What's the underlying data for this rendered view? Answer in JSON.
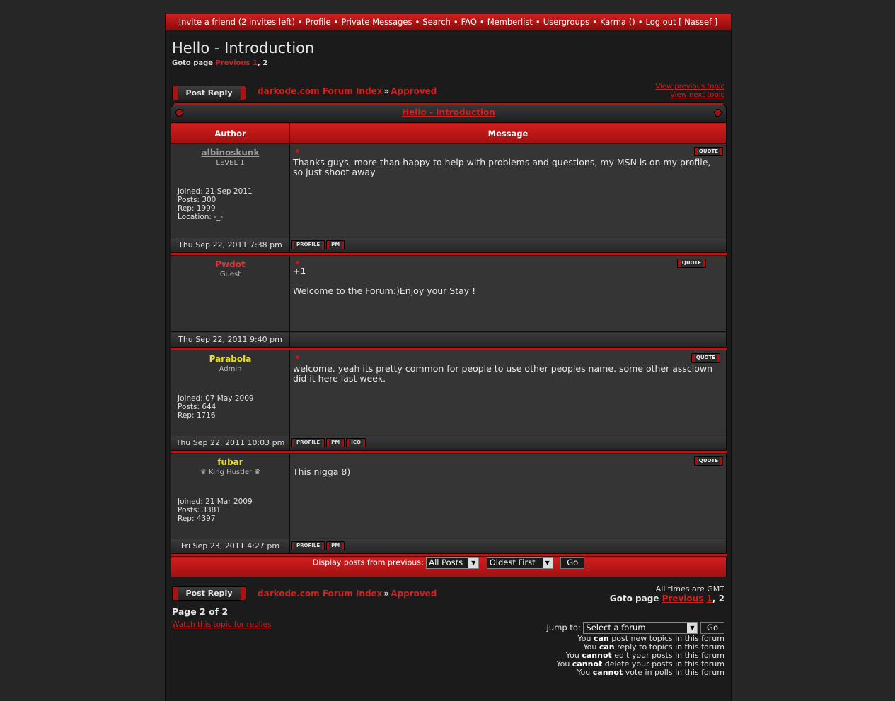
{
  "nav": {
    "items": [
      "Invite a friend (2 invites left)",
      "Profile",
      "Private Messages",
      "Search",
      "FAQ",
      "Memberlist",
      "Usergroups",
      "Karma ()",
      "Log out [ Nassef ]"
    ]
  },
  "topic": {
    "title": "Hello - Introduction",
    "goto_label": "Goto page",
    "goto_prev": "Previous",
    "page1": "1",
    "page2": "2"
  },
  "buttons": {
    "post_reply": "Post Reply",
    "go": "Go",
    "quote": "QUOTE",
    "profile": "PROFILE",
    "pm": "PM",
    "icq": "ICQ"
  },
  "breadcrumb": {
    "index": "darkode.com Forum Index",
    "sep": "»",
    "forum": "Approved"
  },
  "topiclinks": {
    "prev": "View previous topic",
    "next": "View next topic"
  },
  "table": {
    "author_header": "Author",
    "message_header": "Message"
  },
  "posts": [
    {
      "name": "albinoskunk",
      "rank": "LEVEL 1",
      "joined": "Joined: 21 Sep 2011",
      "posts": "Posts: 300",
      "rep": "Rep: 1999",
      "location": "Location: -_-'",
      "body": "Thanks guys, more than happy to help with problems and questions, my MSN is on my profile, so just shoot away",
      "date": "Thu Sep 22, 2011 7:38 pm"
    },
    {
      "name": "Pwdot",
      "rank": "Guest",
      "body1": "+1",
      "body2": "Welcome to the Forum:)Enjoy your Stay !",
      "date": "Thu Sep 22, 2011 9:40 pm"
    },
    {
      "name": "Parabola",
      "rank": "Admin",
      "joined": "Joined: 07 May 2009",
      "posts": "Posts: 644",
      "rep": "Rep: 1716",
      "body": "welcome. yeah its pretty common for people to use other peoples name. some other assclown did it here last week.",
      "date": "Thu Sep 22, 2011 10:03 pm"
    },
    {
      "name": "fubar",
      "rank": "♛ King Hustler ♛",
      "joined": "Joined: 21 Mar 2009",
      "posts": "Posts: 3381",
      "rep": "Rep: 4397",
      "body": "This nigga 8)",
      "date": "Fri Sep 23, 2011 4:27 pm"
    }
  ],
  "display": {
    "label": "Display posts from previous:",
    "range": "All Posts",
    "order": "Oldest First"
  },
  "footer": {
    "timezone": "All times are GMT",
    "page_of": "Page 2 of 2",
    "watch": "Watch this topic for replies",
    "jump_label": "Jump to:",
    "jump_value": "Select a forum"
  },
  "permissions": [
    {
      "pre": "You ",
      "bold": "can",
      "post": " post new topics in this forum"
    },
    {
      "pre": "You ",
      "bold": "can",
      "post": " reply to topics in this forum"
    },
    {
      "pre": "You ",
      "bold": "cannot",
      "post": " edit your posts in this forum"
    },
    {
      "pre": "You ",
      "bold": "cannot",
      "post": " delete your posts in this forum"
    },
    {
      "pre": "You ",
      "bold": "cannot",
      "post": " vote in polls in this forum"
    }
  ],
  "colors": {
    "accent": "#d21e1e",
    "admin": "#f0e020",
    "guest": "#e03030",
    "inactive": "#9a9a9a"
  }
}
